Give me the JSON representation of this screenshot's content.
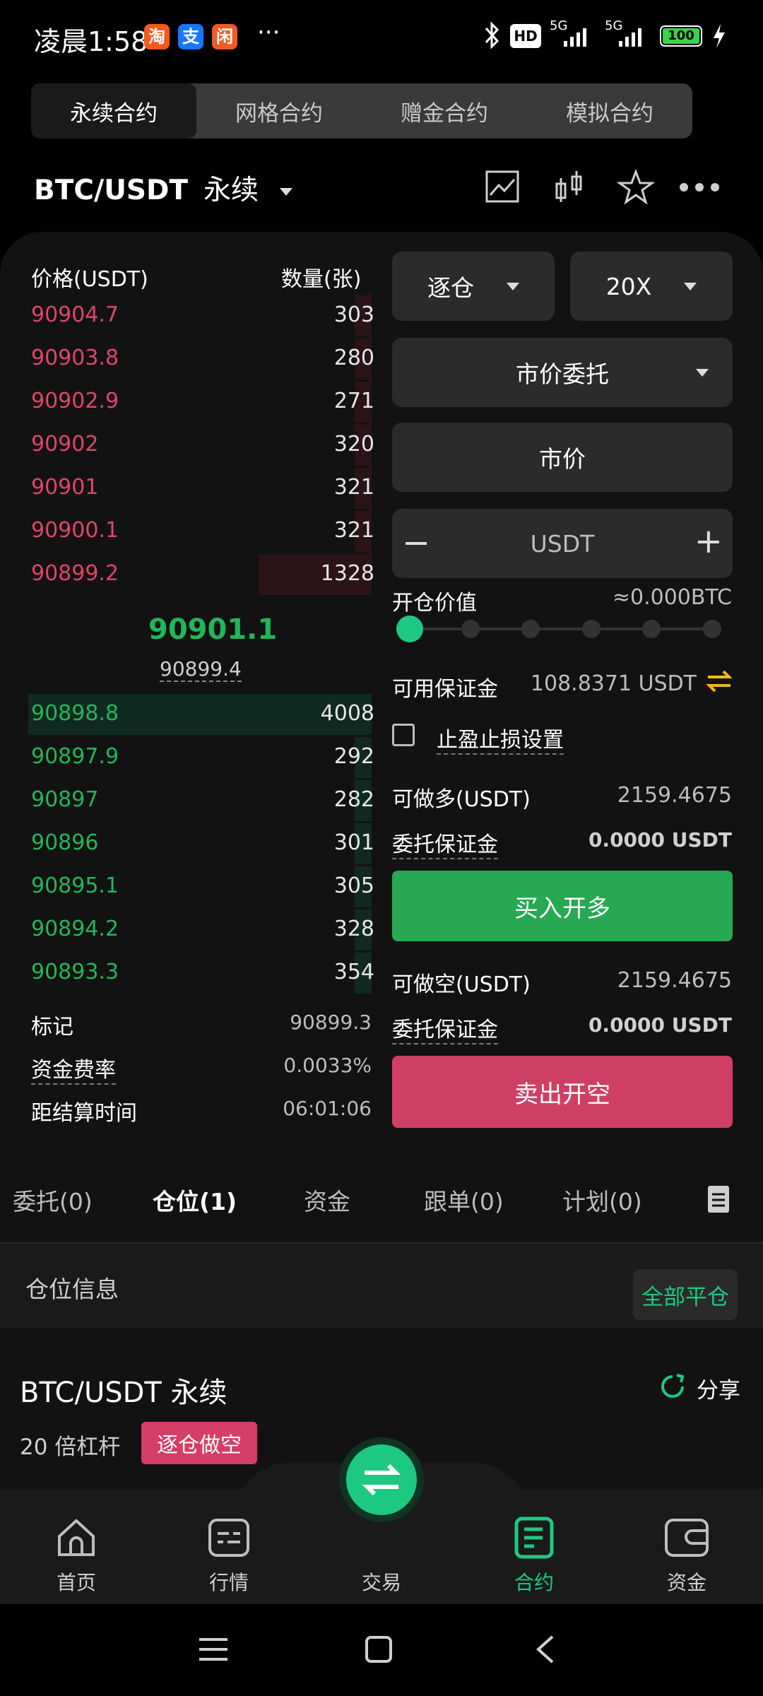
{
  "status_bar": {
    "time": "凌晨1:58",
    "apps": [
      "淘",
      "支",
      "闲"
    ],
    "more": "···",
    "hd": "HD",
    "net1": "5G",
    "net2": "5G",
    "battery": "100"
  },
  "contract_tabs": [
    "永续合约",
    "网格合约",
    "赠金合约",
    "模拟合约"
  ],
  "symbol": {
    "pair": "BTC/USDT",
    "type": "永续"
  },
  "orderbook": {
    "price_header": "价格(USDT)",
    "qty_header": "数量(张)",
    "asks": [
      {
        "price": "90904.7",
        "qty": "303",
        "depth": 0.05
      },
      {
        "price": "90903.8",
        "qty": "280",
        "depth": 0.05
      },
      {
        "price": "90902.9",
        "qty": "271",
        "depth": 0.05
      },
      {
        "price": "90902",
        "qty": "320",
        "depth": 0.05
      },
      {
        "price": "90901",
        "qty": "321",
        "depth": 0.05
      },
      {
        "price": "90900.1",
        "qty": "321",
        "depth": 0.05
      },
      {
        "price": "90899.2",
        "qty": "1328",
        "depth": 0.33
      }
    ],
    "last_price": "90901.1",
    "mark_price_sub": "90899.4",
    "bids": [
      {
        "price": "90898.8",
        "qty": "4008",
        "depth": 1.0
      },
      {
        "price": "90897.9",
        "qty": "292",
        "depth": 0.05
      },
      {
        "price": "90897",
        "qty": "282",
        "depth": 0.05
      },
      {
        "price": "90896",
        "qty": "301",
        "depth": 0.05
      },
      {
        "price": "90895.1",
        "qty": "305",
        "depth": 0.05
      },
      {
        "price": "90894.2",
        "qty": "328",
        "depth": 0.05
      },
      {
        "price": "90893.3",
        "qty": "354",
        "depth": 0.05
      }
    ],
    "mark_label": "标记",
    "mark_value": "90899.3",
    "funding_label": "资金费率",
    "funding_value": "0.0033%",
    "settle_label": "距结算时间",
    "settle_value": "06:01:06"
  },
  "order_form": {
    "margin_mode": "逐仓",
    "leverage": "20X",
    "order_type": "市价委托",
    "price_field": "市价",
    "qty_minus": "−",
    "qty_placeholder": "USDT",
    "qty_plus": "+",
    "open_value_label": "开仓价值",
    "open_value": "≈0.000BTC",
    "slider_percent": 0,
    "available_label": "可用保证金",
    "available_value": "108.8371 USDT",
    "tpsl_label": "止盈止损设置",
    "long_max_label": "可做多(USDT)",
    "long_max_value": "2159.4675",
    "long_margin_label": "委托保证金",
    "long_margin_value": "0.0000 USDT",
    "buy_button": "买入开多",
    "short_max_label": "可做空(USDT)",
    "short_max_value": "2159.4675",
    "short_margin_label": "委托保证金",
    "short_margin_value": "0.0000 USDT",
    "sell_button": "卖出开空"
  },
  "bottom_tabs": [
    "委托(0)",
    "仓位(1)",
    "资金",
    "跟单(0)",
    "计划(0)"
  ],
  "positions": {
    "title": "仓位信息",
    "close_all": "全部平仓",
    "position_name": "BTC/USDT 永续",
    "share": "分享",
    "leverage": "20 倍杠杆",
    "side_badge": "逐仓做空"
  },
  "nav": [
    "首页",
    "行情",
    "交易",
    "合约",
    "资金"
  ],
  "colors": {
    "green": "#21b65a",
    "red": "#e0446a",
    "buy_btn": "#27a853",
    "sell_btn": "#cf3f64",
    "accent": "#1dc980"
  }
}
